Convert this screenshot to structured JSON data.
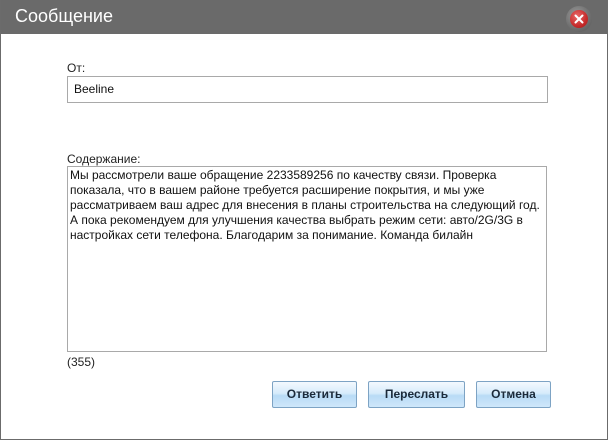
{
  "dialog": {
    "title": "Сообщение",
    "close_icon": "close-icon"
  },
  "from": {
    "label": "От:",
    "value": "Beeline"
  },
  "content": {
    "label": "Содержание:",
    "text": "Мы рассмотрели ваше обращение 2233589256 по качеству связи. Проверка\nпоказала, что в вашем районе требуется расширение покрытия, и мы уже\nрассматриваем ваш адрес для внесения в планы строительства на следующий год.\nА пока рекомендуем для улучшения качества выбрать режим сети: авто/2G/3G в\nнастройках сети телефона. Благодарим за понимание. Команда билайн",
    "char_count": "(355)"
  },
  "buttons": {
    "reply": "Ответить",
    "forward": "Переслать",
    "cancel": "Отмена"
  },
  "colors": {
    "titlebar": "#6a6a6a",
    "close": "#c62b2b",
    "button_gradient_top": "#f3f9fe",
    "button_gradient_bottom": "#b8dbf6",
    "button_border": "#7da3c4"
  }
}
